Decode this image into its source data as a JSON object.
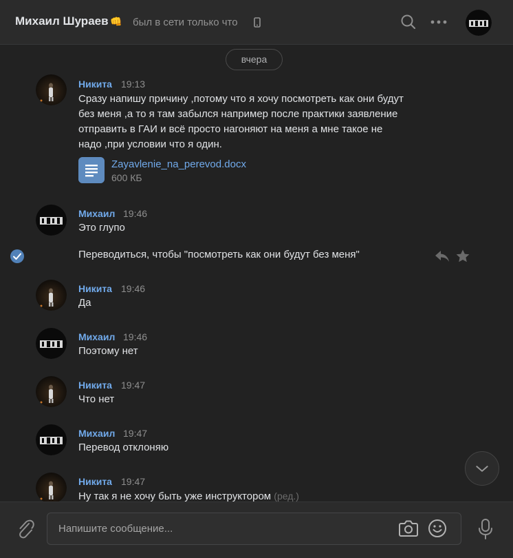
{
  "header": {
    "name": "Михаил Шураев",
    "emoji": "👊",
    "status": "был в сети только что"
  },
  "feed": {
    "date_divider": "вчера",
    "messages": [
      {
        "author": "Никита",
        "time": "19:13",
        "lines": [
          "Сразу напишу причину ,потому что я хочу посмотреть как они будут",
          "без меня ,а то я там забылся например после практики заявление",
          "отправить в ГАИ и всё просто нагоняют на меня а мне такое не",
          "надо ,при условии что я один."
        ],
        "attachment": {
          "name": "Zayavlenie_na_perevod.docx",
          "size": "600 КБ"
        }
      },
      {
        "author": "Михаил",
        "time": "19:46",
        "text": "Это глупо"
      },
      {
        "text": "Переводиться, чтобы \"посмотреть как они будут без меня\"",
        "selected": true
      },
      {
        "author": "Никита",
        "time": "19:46",
        "text": "Да"
      },
      {
        "author": "Михаил",
        "time": "19:46",
        "text": "Поэтому нет"
      },
      {
        "author": "Никита",
        "time": "19:47",
        "text": "Что нет"
      },
      {
        "author": "Михаил",
        "time": "19:47",
        "text": "Перевод отклоняю"
      },
      {
        "author": "Никита",
        "time": "19:47",
        "text": "Ну так я не хочу быть уже инструктором",
        "edited": "(ред.)"
      }
    ]
  },
  "composer": {
    "placeholder": "Напишите сообщение...",
    "value": ""
  },
  "colors": {
    "background": "#222222",
    "header": "#2b2b2b",
    "accent": "#71aaeb",
    "text": "#e1e3e6",
    "muted": "#8e8e8e"
  },
  "icons": [
    "search-icon",
    "more-icon",
    "phone-icon",
    "document-icon",
    "check-icon",
    "reply-icon",
    "star-icon",
    "chevron-down-icon",
    "paperclip-icon",
    "camera-icon",
    "emoji-icon",
    "mic-icon"
  ]
}
